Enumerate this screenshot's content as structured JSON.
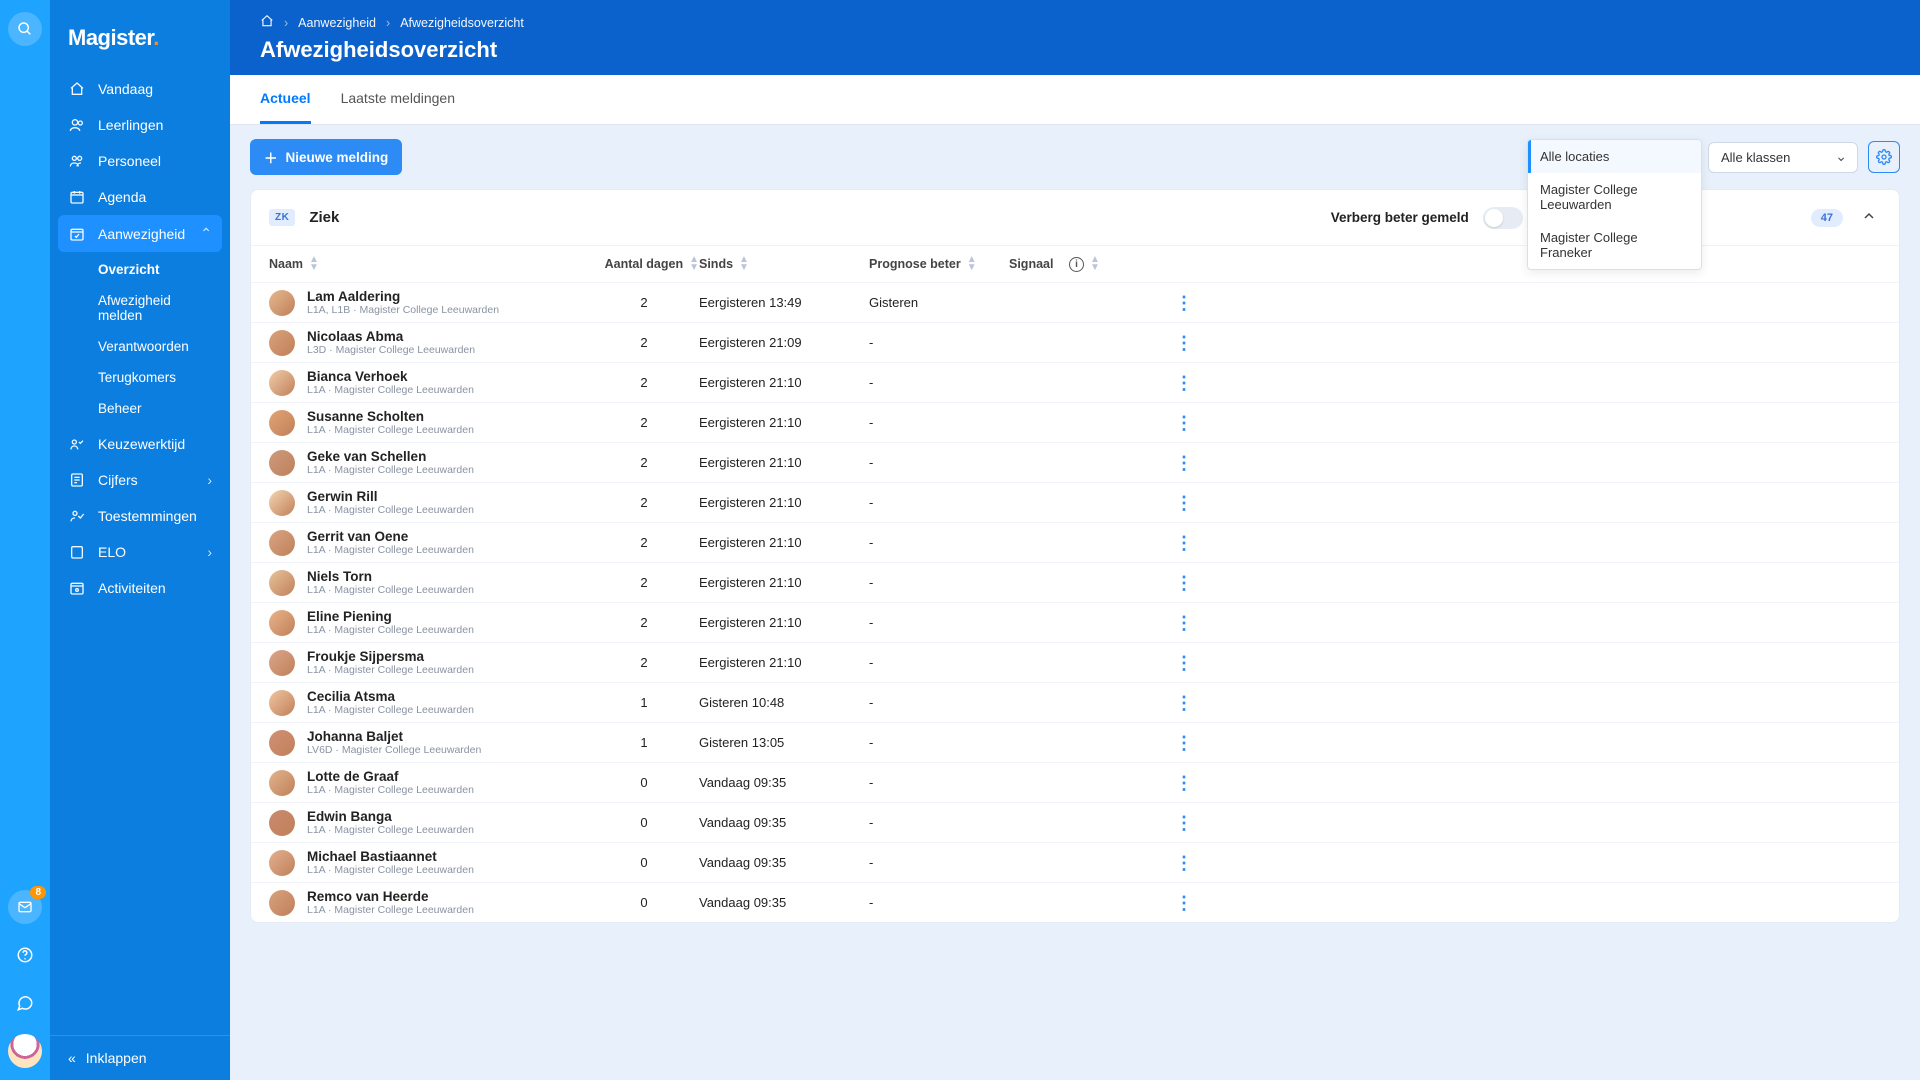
{
  "app": {
    "brand": "Magister",
    "brand_dot": "."
  },
  "rail": {
    "notification_count": "8"
  },
  "nav": {
    "items": [
      {
        "key": "vandaag",
        "label": "Vandaag"
      },
      {
        "key": "leerlingen",
        "label": "Leerlingen"
      },
      {
        "key": "personeel",
        "label": "Personeel"
      },
      {
        "key": "agenda",
        "label": "Agenda"
      },
      {
        "key": "aanwezigheid",
        "label": "Aanwezigheid",
        "expanded": true
      },
      {
        "key": "keuzewerktijd",
        "label": "Keuzewerktijd"
      },
      {
        "key": "cijfers",
        "label": "Cijfers",
        "expandable": true
      },
      {
        "key": "toestemmingen",
        "label": "Toestemmingen"
      },
      {
        "key": "elo",
        "label": "ELO",
        "expandable": true
      },
      {
        "key": "activiteiten",
        "label": "Activiteiten"
      }
    ],
    "aanwezigheid_children": [
      {
        "key": "overzicht",
        "label": "Overzicht",
        "selected": true
      },
      {
        "key": "afw-melden",
        "label": "Afwezigheid melden"
      },
      {
        "key": "verantwoorden",
        "label": "Verantwoorden"
      },
      {
        "key": "terugkomers",
        "label": "Terugkomers"
      },
      {
        "key": "beheer",
        "label": "Beheer"
      }
    ],
    "collapse_label": "Inklappen"
  },
  "breadcrumb": {
    "home_icon": "home",
    "level1": "Aanwezigheid",
    "level2": "Afwezigheidsoverzicht"
  },
  "page": {
    "title": "Afwezigheidsoverzicht"
  },
  "tabs": [
    {
      "label": "Actueel",
      "active": true
    },
    {
      "label": "Laatste meldingen"
    }
  ],
  "actions": {
    "new_button": "Nieuwe melding",
    "location_dropdown": {
      "options": [
        "Alle locaties",
        "Magister College Leeuwarden",
        "Magister College Franeker"
      ],
      "selected": "Alle locaties"
    },
    "class_dropdown": {
      "selected": "Alle klassen"
    }
  },
  "card": {
    "tag": "ZK",
    "title": "Ziek",
    "hide_label": "Verberg beter gemeld",
    "count": "47",
    "columns": {
      "name": "Naam",
      "days": "Aantal dagen",
      "since": "Sinds",
      "prognosis": "Prognose beter",
      "signal": "Signaal"
    },
    "rows": [
      {
        "name": "Lam Aaldering",
        "meta": "L1A, L1B · Magister College Leeuwarden",
        "days": "2",
        "since": "Eergisteren 13:49",
        "prognosis": "Gisteren"
      },
      {
        "name": "Nicolaas Abma",
        "meta": "L3D · Magister College Leeuwarden",
        "days": "2",
        "since": "Eergisteren 21:09",
        "prognosis": "-"
      },
      {
        "name": "Bianca Verhoek",
        "meta": "L1A · Magister College Leeuwarden",
        "days": "2",
        "since": "Eergisteren 21:10",
        "prognosis": "-"
      },
      {
        "name": "Susanne Scholten",
        "meta": "L1A · Magister College Leeuwarden",
        "days": "2",
        "since": "Eergisteren 21:10",
        "prognosis": "-"
      },
      {
        "name": "Geke van Schellen",
        "meta": "L1A · Magister College Leeuwarden",
        "days": "2",
        "since": "Eergisteren 21:10",
        "prognosis": "-"
      },
      {
        "name": "Gerwin Rill",
        "meta": "L1A · Magister College Leeuwarden",
        "days": "2",
        "since": "Eergisteren 21:10",
        "prognosis": "-"
      },
      {
        "name": "Gerrit van Oene",
        "meta": "L1A · Magister College Leeuwarden",
        "days": "2",
        "since": "Eergisteren 21:10",
        "prognosis": "-"
      },
      {
        "name": "Niels Torn",
        "meta": "L1A · Magister College Leeuwarden",
        "days": "2",
        "since": "Eergisteren 21:10",
        "prognosis": "-"
      },
      {
        "name": "Eline Piening",
        "meta": "L1A · Magister College Leeuwarden",
        "days": "2",
        "since": "Eergisteren 21:10",
        "prognosis": "-"
      },
      {
        "name": "Froukje Sijpersma",
        "meta": "L1A · Magister College Leeuwarden",
        "days": "2",
        "since": "Eergisteren 21:10",
        "prognosis": "-"
      },
      {
        "name": "Cecilia Atsma",
        "meta": "L1A · Magister College Leeuwarden",
        "days": "1",
        "since": "Gisteren 10:48",
        "prognosis": "-"
      },
      {
        "name": "Johanna Baljet",
        "meta": "LV6D · Magister College Leeuwarden",
        "days": "1",
        "since": "Gisteren 13:05",
        "prognosis": "-"
      },
      {
        "name": "Lotte de Graaf",
        "meta": "L1A · Magister College Leeuwarden",
        "days": "0",
        "since": "Vandaag 09:35",
        "prognosis": "-"
      },
      {
        "name": "Edwin Banga",
        "meta": "L1A · Magister College Leeuwarden",
        "days": "0",
        "since": "Vandaag 09:35",
        "prognosis": "-"
      },
      {
        "name": "Michael Bastiaannet",
        "meta": "L1A · Magister College Leeuwarden",
        "days": "0",
        "since": "Vandaag 09:35",
        "prognosis": "-"
      },
      {
        "name": "Remco van Heerde",
        "meta": "L1A · Magister College Leeuwarden",
        "days": "0",
        "since": "Vandaag 09:35",
        "prognosis": "-"
      }
    ]
  }
}
